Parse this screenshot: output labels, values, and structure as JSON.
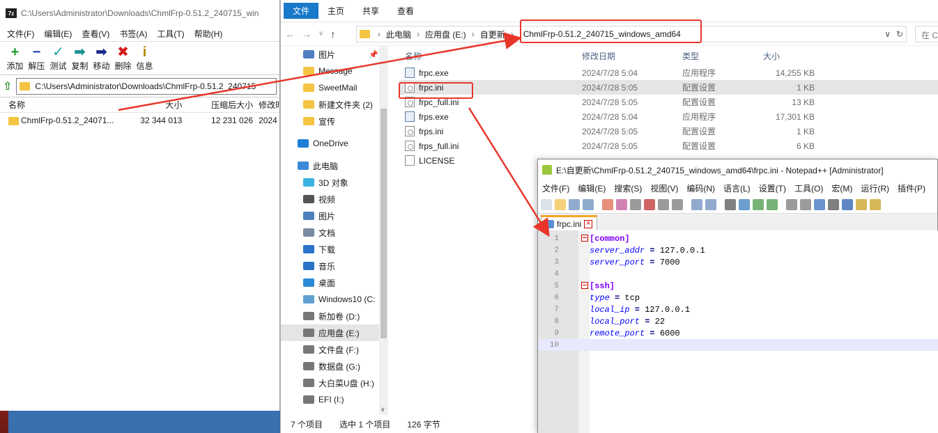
{
  "zip": {
    "title": "C:\\Users\\Administrator\\Downloads\\ChmlFrp-0.51.2_240715_win",
    "logo": "7z",
    "menu": [
      "文件(F)",
      "编辑(E)",
      "查看(V)",
      "书签(A)",
      "工具(T)",
      "帮助(H)"
    ],
    "tools": [
      {
        "label": "添加",
        "icon": "plus-icon",
        "glyph": "+",
        "color": "#1e9e2e"
      },
      {
        "label": "解压",
        "icon": "minus-icon",
        "glyph": "−",
        "color": "#1a3fa8"
      },
      {
        "label": "测试",
        "icon": "check-icon",
        "glyph": "✓",
        "color": "#1aa0a0"
      },
      {
        "label": "复制",
        "icon": "double-arrow-icon",
        "glyph": "➡",
        "color": "#1a9090"
      },
      {
        "label": "移动",
        "icon": "arrow-right-icon",
        "glyph": "➡",
        "color": "#1a2a8a"
      },
      {
        "label": "删除",
        "icon": "delete-x-icon",
        "glyph": "✖",
        "color": "#d41a1a"
      },
      {
        "label": "信息",
        "icon": "info-icon",
        "glyph": "i",
        "color": "#b08a00"
      }
    ],
    "address": "C:\\Users\\Administrator\\Downloads\\ChmlFrp-0.51.2_240715",
    "columns": {
      "name": "名称",
      "size": "大小",
      "packed": "压缩后大小",
      "modified": "修改时"
    },
    "rows": [
      {
        "name": "ChmlFrp-0.51.2_24071...",
        "size": "32 344 013",
        "packed": "12 231 026",
        "modified": "2024"
      }
    ]
  },
  "explorer": {
    "ribbon": [
      "文件",
      "主页",
      "共享",
      "查看"
    ],
    "breadcrumb": [
      "此电脑",
      "应用盘 (E:)",
      "自更新"
    ],
    "current_folder": "ChmlFrp-0.51.2_240715_windows_amd64",
    "search_placeholder": "在 C",
    "nav": [
      {
        "label": "图片",
        "icon": "pictures-icon",
        "color": "#4f7fbf"
      },
      {
        "label": "Message",
        "icon": "folder-icon",
        "color": "#f4c542"
      },
      {
        "label": "SweetMail",
        "icon": "folder-icon",
        "color": "#f4c542"
      },
      {
        "label": "新建文件夹 (2)",
        "icon": "folder-icon",
        "color": "#f4c542"
      },
      {
        "label": "宣传",
        "icon": "folder-icon",
        "color": "#f4c542"
      },
      {
        "label": "",
        "icon": "",
        "color": ""
      },
      {
        "label": "OneDrive",
        "icon": "onedrive-icon",
        "color": "#1e7fd6"
      },
      {
        "label": "",
        "icon": "",
        "color": ""
      },
      {
        "label": "此电脑",
        "icon": "computer-icon",
        "color": "#3a8ad8"
      },
      {
        "label": "3D 对象",
        "icon": "3d-objects-icon",
        "color": "#39b3e0"
      },
      {
        "label": "视频",
        "icon": "video-icon",
        "color": "#555"
      },
      {
        "label": "图片",
        "icon": "pictures-icon",
        "color": "#4f7fbf"
      },
      {
        "label": "文档",
        "icon": "documents-icon",
        "color": "#7a8ba0"
      },
      {
        "label": "下载",
        "icon": "download-icon",
        "color": "#2a73c8"
      },
      {
        "label": "音乐",
        "icon": "music-icon",
        "color": "#2a73c8"
      },
      {
        "label": "桌面",
        "icon": "desktop-icon",
        "color": "#2a8ad8"
      },
      {
        "label": "Windows10 (C:",
        "icon": "drive-c-icon",
        "color": "#5fa0d0"
      },
      {
        "label": "新加卷 (D:)",
        "icon": "drive-icon",
        "color": "#777"
      },
      {
        "label": "应用盘 (E:)",
        "icon": "drive-icon",
        "color": "#777"
      },
      {
        "label": "文件盘 (F:)",
        "icon": "drive-icon",
        "color": "#777"
      },
      {
        "label": "数据盘 (G:)",
        "icon": "drive-icon",
        "color": "#777"
      },
      {
        "label": "大白菜U盘 (H:)",
        "icon": "usb-drive-icon",
        "color": "#777"
      },
      {
        "label": "EFI (I:)",
        "icon": "drive-icon",
        "color": "#777"
      }
    ],
    "columns": {
      "name": "名称",
      "modified": "修改日期",
      "type": "类型",
      "size": "大小"
    },
    "files": [
      {
        "name": "frpc.exe",
        "modified": "2024/7/28 5:04",
        "type": "应用程序",
        "size": "14,255 KB",
        "kind": "exe"
      },
      {
        "name": "frpc.ini",
        "modified": "2024/7/28 5:05",
        "type": "配置设置",
        "size": "1 KB",
        "kind": "ini"
      },
      {
        "name": "frpc_full.ini",
        "modified": "2024/7/28 5:05",
        "type": "配置设置",
        "size": "13 KB",
        "kind": "ini"
      },
      {
        "name": "frps.exe",
        "modified": "2024/7/28 5:04",
        "type": "应用程序",
        "size": "17,301 KB",
        "kind": "exe"
      },
      {
        "name": "frps.ini",
        "modified": "2024/7/28 5:05",
        "type": "配置设置",
        "size": "1 KB",
        "kind": "ini"
      },
      {
        "name": "frps_full.ini",
        "modified": "2024/7/28 5:05",
        "type": "配置设置",
        "size": "6 KB",
        "kind": "ini"
      },
      {
        "name": "LICENSE",
        "modified": "",
        "type": "",
        "size": "",
        "kind": "file"
      }
    ],
    "status": {
      "count": "7 个项目",
      "selected": "选中 1 个项目",
      "size": "126 字节"
    }
  },
  "notepad": {
    "title": "E:\\自更新\\ChmlFrp-0.51.2_240715_windows_amd64\\frpc.ini - Notepad++ [Administrator]",
    "menu": [
      "文件(F)",
      "编辑(E)",
      "搜索(S)",
      "视图(V)",
      "编码(N)",
      "语言(L)",
      "设置(T)",
      "工具(O)",
      "宏(M)",
      "运行(R)",
      "插件(P)"
    ],
    "tab": "frpc.ini",
    "lines": [
      {
        "n": "1",
        "section": "[common]",
        "key": "",
        "value": ""
      },
      {
        "n": "2",
        "section": "",
        "key": "server_addr",
        "value": "127.0.0.1"
      },
      {
        "n": "3",
        "section": "",
        "key": "server_port",
        "value": "7000"
      },
      {
        "n": "4",
        "section": "",
        "key": "",
        "value": ""
      },
      {
        "n": "5",
        "section": "[ssh]",
        "key": "",
        "value": ""
      },
      {
        "n": "6",
        "section": "",
        "key": "type",
        "value": "tcp"
      },
      {
        "n": "7",
        "section": "",
        "key": "local_ip",
        "value": "127.0.0.1"
      },
      {
        "n": "8",
        "section": "",
        "key": "local_port",
        "value": "22"
      },
      {
        "n": "9",
        "section": "",
        "key": "remote_port",
        "value": "6000"
      },
      {
        "n": "10",
        "section": "",
        "key": "",
        "value": ""
      }
    ]
  },
  "colors": {
    "accent": "#1979ca",
    "annotation": "#e8362b",
    "section": "#8000ff",
    "key": "#0000ff"
  }
}
